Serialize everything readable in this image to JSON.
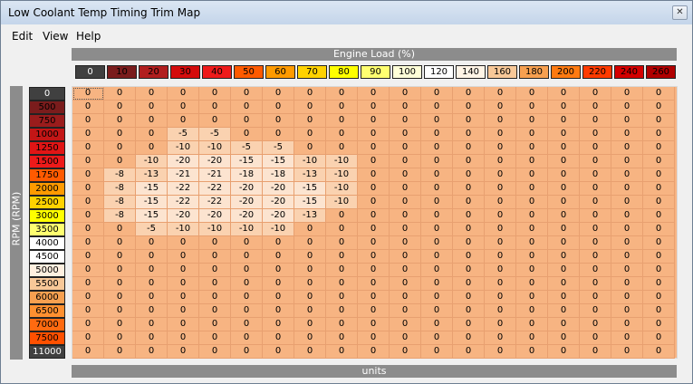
{
  "window": {
    "title": "Low Coolant Temp Timing Trim Map",
    "close_symbol": "✕"
  },
  "menu": {
    "items": [
      "Edit",
      "View",
      "Help"
    ]
  },
  "table": {
    "load_label": "Engine Load (%)",
    "rpm_label": "RPM (RPM)",
    "units_label": "units",
    "columns": [
      "0",
      "10",
      "20",
      "30",
      "40",
      "50",
      "60",
      "70",
      "80",
      "90",
      "100",
      "120",
      "140",
      "160",
      "180",
      "200",
      "220",
      "240",
      "260"
    ],
    "column_colors": [
      "#404040",
      "#7a1c1c",
      "#b11e1e",
      "#d40c0c",
      "#ee1a1a",
      "#ff5a00",
      "#ff9a00",
      "#ffd200",
      "#ffff00",
      "#ffff70",
      "#ffffd8",
      "#ffffff",
      "#fff4e6",
      "#f8c898",
      "#f7a050",
      "#ff7a10",
      "#ff3a00",
      "#d40000",
      "#b00000"
    ],
    "rows": [
      "0",
      "500",
      "750",
      "1000",
      "1250",
      "1500",
      "1750",
      "2000",
      "2500",
      "3000",
      "3500",
      "4000",
      "4500",
      "5000",
      "5500",
      "6000",
      "6500",
      "7000",
      "7500",
      "11000"
    ],
    "row_colors": [
      "#404040",
      "#7a1c1c",
      "#9a1c1c",
      "#c31616",
      "#e11515",
      "#ee1a1a",
      "#ff5a00",
      "#ff9a00",
      "#ffd200",
      "#ffff00",
      "#ffff70",
      "#ffffff",
      "#ffffff",
      "#fff0e0",
      "#f8c898",
      "#f7a050",
      "#ff9030",
      "#ff6a10",
      "#ff5000",
      "#404040"
    ],
    "values": [
      [
        0,
        0,
        0,
        0,
        0,
        0,
        0,
        0,
        0,
        0,
        0,
        0,
        0,
        0,
        0,
        0,
        0,
        0,
        0
      ],
      [
        0,
        0,
        0,
        0,
        0,
        0,
        0,
        0,
        0,
        0,
        0,
        0,
        0,
        0,
        0,
        0,
        0,
        0,
        0
      ],
      [
        0,
        0,
        0,
        0,
        0,
        0,
        0,
        0,
        0,
        0,
        0,
        0,
        0,
        0,
        0,
        0,
        0,
        0,
        0
      ],
      [
        0,
        0,
        0,
        -5,
        -5,
        0,
        0,
        0,
        0,
        0,
        0,
        0,
        0,
        0,
        0,
        0,
        0,
        0,
        0
      ],
      [
        0,
        0,
        0,
        -10,
        -10,
        -5,
        -5,
        0,
        0,
        0,
        0,
        0,
        0,
        0,
        0,
        0,
        0,
        0,
        0
      ],
      [
        0,
        0,
        -10,
        -20,
        -20,
        -15,
        -15,
        -10,
        -10,
        0,
        0,
        0,
        0,
        0,
        0,
        0,
        0,
        0,
        0
      ],
      [
        0,
        -8,
        -13,
        -21,
        -21,
        -18,
        -18,
        -13,
        -10,
        0,
        0,
        0,
        0,
        0,
        0,
        0,
        0,
        0,
        0
      ],
      [
        0,
        -8,
        -15,
        -22,
        -22,
        -20,
        -20,
        -15,
        -10,
        0,
        0,
        0,
        0,
        0,
        0,
        0,
        0,
        0,
        0
      ],
      [
        0,
        -8,
        -15,
        -22,
        -22,
        -20,
        -20,
        -15,
        -10,
        0,
        0,
        0,
        0,
        0,
        0,
        0,
        0,
        0,
        0
      ],
      [
        0,
        -8,
        -15,
        -20,
        -20,
        -20,
        -20,
        -13,
        0,
        0,
        0,
        0,
        0,
        0,
        0,
        0,
        0,
        0,
        0
      ],
      [
        0,
        0,
        -5,
        -10,
        -10,
        -10,
        -10,
        0,
        0,
        0,
        0,
        0,
        0,
        0,
        0,
        0,
        0,
        0,
        0
      ],
      [
        0,
        0,
        0,
        0,
        0,
        0,
        0,
        0,
        0,
        0,
        0,
        0,
        0,
        0,
        0,
        0,
        0,
        0,
        0
      ],
      [
        0,
        0,
        0,
        0,
        0,
        0,
        0,
        0,
        0,
        0,
        0,
        0,
        0,
        0,
        0,
        0,
        0,
        0,
        0
      ],
      [
        0,
        0,
        0,
        0,
        0,
        0,
        0,
        0,
        0,
        0,
        0,
        0,
        0,
        0,
        0,
        0,
        0,
        0,
        0
      ],
      [
        0,
        0,
        0,
        0,
        0,
        0,
        0,
        0,
        0,
        0,
        0,
        0,
        0,
        0,
        0,
        0,
        0,
        0,
        0
      ],
      [
        0,
        0,
        0,
        0,
        0,
        0,
        0,
        0,
        0,
        0,
        0,
        0,
        0,
        0,
        0,
        0,
        0,
        0,
        0
      ],
      [
        0,
        0,
        0,
        0,
        0,
        0,
        0,
        0,
        0,
        0,
        0,
        0,
        0,
        0,
        0,
        0,
        0,
        0,
        0
      ],
      [
        0,
        0,
        0,
        0,
        0,
        0,
        0,
        0,
        0,
        0,
        0,
        0,
        0,
        0,
        0,
        0,
        0,
        0,
        0
      ],
      [
        0,
        0,
        0,
        0,
        0,
        0,
        0,
        0,
        0,
        0,
        0,
        0,
        0,
        0,
        0,
        0,
        0,
        0,
        0
      ],
      [
        0,
        0,
        0,
        0,
        0,
        0,
        0,
        0,
        0,
        0,
        0,
        0,
        0,
        0,
        0,
        0,
        0,
        0,
        0
      ]
    ],
    "cell_base_color": "#f7b482",
    "cell_light_color": "#fad2b0",
    "cell_lighter_color": "#fce4d0"
  }
}
